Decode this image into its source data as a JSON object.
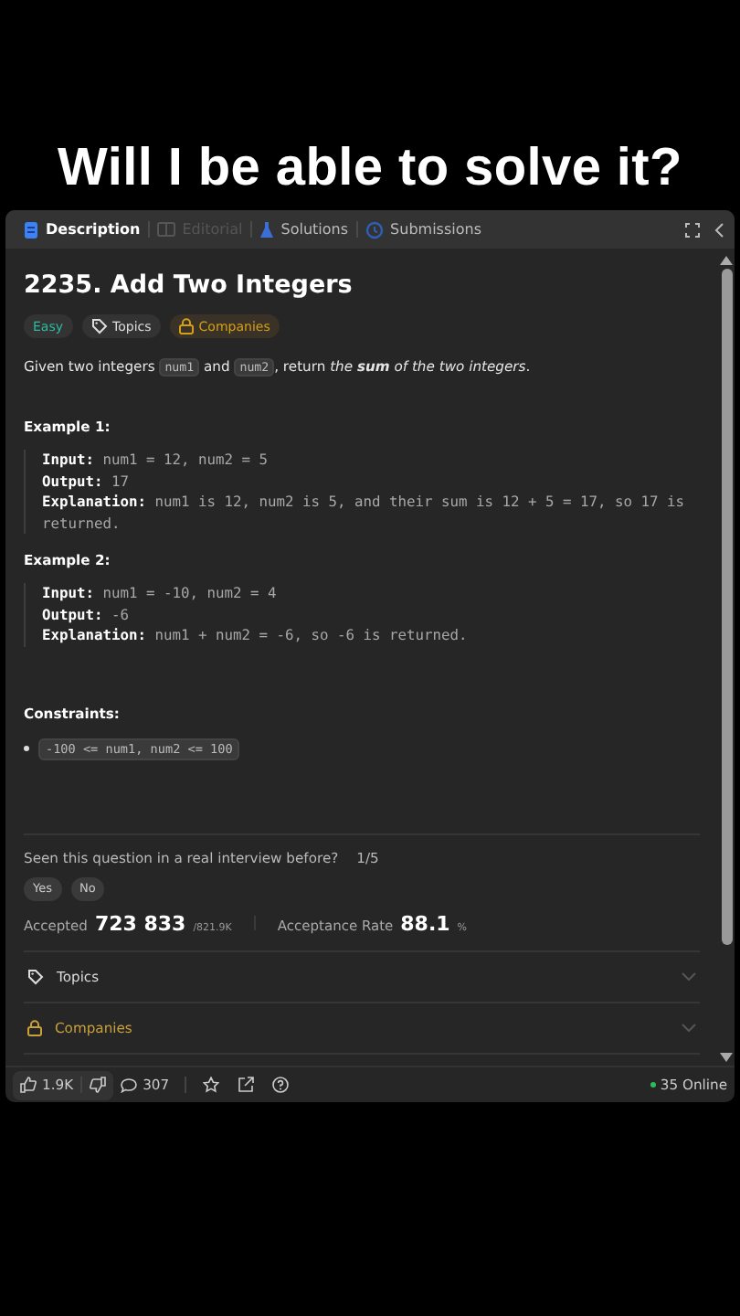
{
  "caption": "Will I be able to solve it?",
  "tabs": [
    {
      "label": "Description",
      "selected": true,
      "disabled": false,
      "kind": "doc"
    },
    {
      "label": "Editorial",
      "selected": false,
      "disabled": true,
      "kind": "book"
    },
    {
      "label": "Solutions",
      "selected": false,
      "disabled": false,
      "kind": "flask"
    },
    {
      "label": "Submissions",
      "selected": false,
      "disabled": false,
      "kind": "history"
    }
  ],
  "problem": {
    "title": "2235. Add Two Integers",
    "tags": [
      {
        "kind": "difficulty",
        "label": "Easy"
      },
      {
        "kind": "topics",
        "label": "Topics"
      },
      {
        "kind": "companies",
        "label": "Companies"
      }
    ],
    "description": [
      {
        "kind": "text",
        "text": "Given two integers "
      },
      {
        "kind": "code",
        "text": "num1"
      },
      {
        "kind": "text",
        "text": " and "
      },
      {
        "kind": "code",
        "text": "num2"
      },
      {
        "kind": "text",
        "text": ", return "
      },
      {
        "kind": "em",
        "text": "the "
      },
      {
        "kind": "strong-em",
        "text": "sum"
      },
      {
        "kind": "em",
        "text": " of the two integers"
      },
      {
        "kind": "text",
        "text": "."
      }
    ],
    "examples": [
      {
        "heading": "Example 1:",
        "lines": [
          {
            "label": "Input:",
            "value": "num1 = 12, num2 = 5"
          },
          {
            "label": "Output:",
            "value": "17"
          },
          {
            "label": "Explanation:",
            "value": "num1 is 12, num2 is 5, and their sum is 12 + 5 = 17, so 17 is returned."
          }
        ]
      },
      {
        "heading": "Example 2:",
        "lines": [
          {
            "label": "Input:",
            "value": "num1 = -10, num2 = 4"
          },
          {
            "label": "Output:",
            "value": "-6"
          },
          {
            "label": "Explanation:",
            "value": "num1 + num2 = -6, so -6 is returned."
          }
        ]
      }
    ],
    "constraints_heading": "Constraints:",
    "constraints": [
      "-100 <= num1, num2 <= 100"
    ]
  },
  "interview": {
    "question": "Seen this question in a real interview before?",
    "count": "1/5",
    "answers": [
      "Yes",
      "No"
    ]
  },
  "stats": {
    "accepted_label": "Accepted",
    "accepted": "723 833",
    "submissions": "/821.9K",
    "rate_label": "Acceptance Rate",
    "rate": "88.1",
    "rate_unit": "%"
  },
  "sections": [
    {
      "kind": "topics",
      "label": "Topics",
      "expanded": false
    },
    {
      "kind": "companies",
      "label": "Companies",
      "expanded": false
    }
  ],
  "footer": {
    "likes": "1.9K",
    "comments": "307",
    "online": "35 Online"
  }
}
